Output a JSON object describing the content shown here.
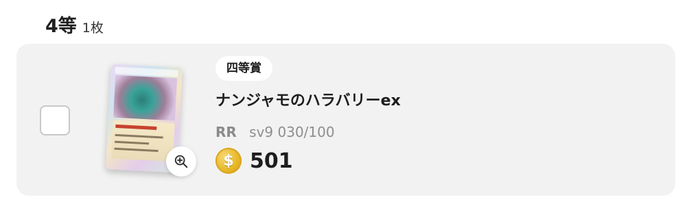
{
  "section": {
    "rank_title": "4等",
    "count": "1枚"
  },
  "card": {
    "prize_badge": "四等賞",
    "name": "ナンジャモのハラバリーex",
    "rarity": "RR",
    "set_number": "sv9 030/100",
    "price": "501",
    "coin_glyph": "$"
  },
  "icons": {
    "zoom": "zoom-in-icon",
    "coin": "coin-icon"
  },
  "colors": {
    "row_background": "#f2f2f2",
    "coin_gold": "#e6b623",
    "meta_gray": "#8e8e8e"
  }
}
